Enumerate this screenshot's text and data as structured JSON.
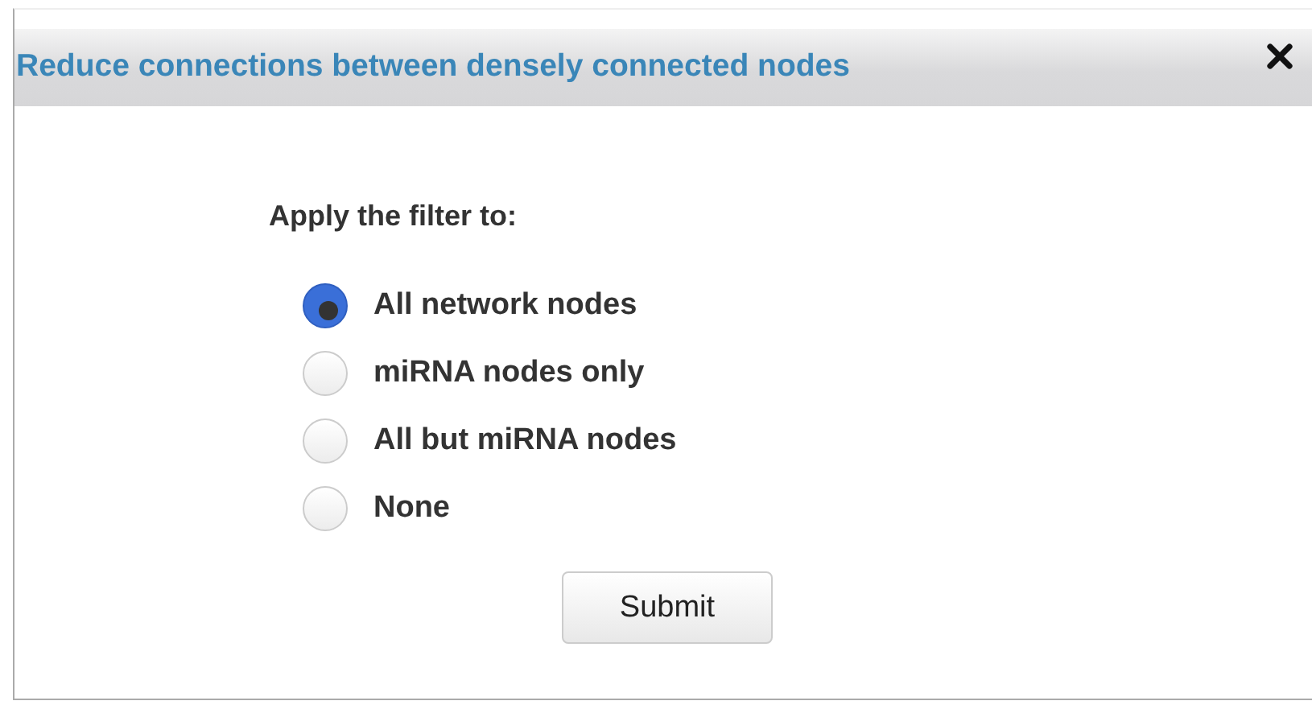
{
  "dialog": {
    "title": "Reduce connections between densely connected nodes"
  },
  "prompt": "Apply the filter to:",
  "options": [
    {
      "label": "All network nodes",
      "selected": true
    },
    {
      "label": "miRNA nodes only",
      "selected": false
    },
    {
      "label": "All but miRNA nodes",
      "selected": false
    },
    {
      "label": "None",
      "selected": false
    }
  ],
  "submit": "Submit"
}
